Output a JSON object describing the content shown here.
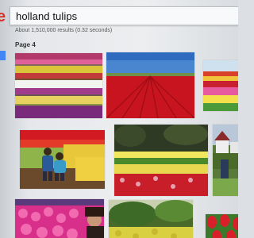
{
  "search": {
    "query": "holland tulips"
  },
  "results": {
    "stats": "About 1,510,000 results (0.32 seconds)",
    "page_label": "Page 4"
  },
  "images": [
    {
      "name": "multicolor tulip rows"
    },
    {
      "name": "red tulip field"
    },
    {
      "name": "striped tulip field"
    },
    {
      "name": "couple in tulip field"
    },
    {
      "name": "tulip garden with trees"
    },
    {
      "name": "tulips and windmill houses"
    },
    {
      "name": "pink tulips with woman"
    },
    {
      "name": "green trees with tulips"
    },
    {
      "name": "red tulips closeup"
    }
  ],
  "colors": {
    "brand_red": "#d93025",
    "accent_blue": "#4285f4"
  }
}
